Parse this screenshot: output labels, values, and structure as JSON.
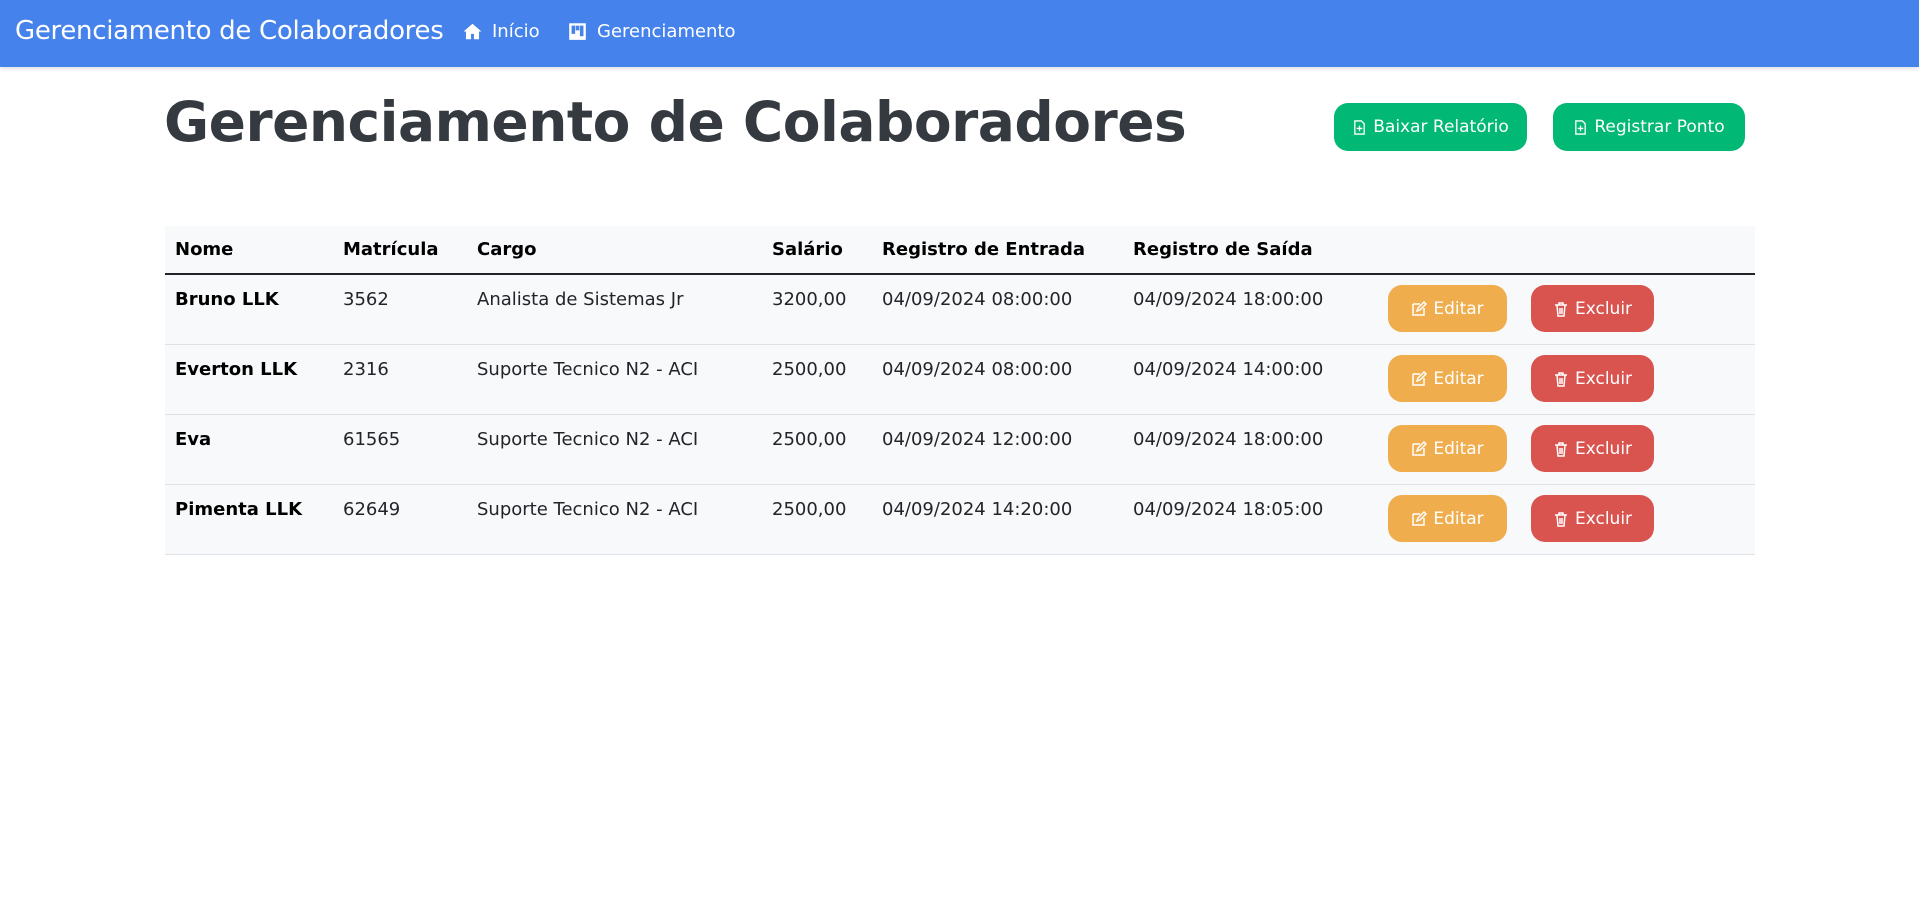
{
  "navbar": {
    "brand": "Gerenciamento de Colaboradores",
    "links": [
      {
        "label": "Início",
        "icon": "home-icon"
      },
      {
        "label": "Gerenciamento",
        "icon": "kanban-icon"
      }
    ],
    "color": "#4582ec"
  },
  "page": {
    "title": "Gerenciamento de Colaboradores",
    "buttons": {
      "report": "Baixar Relatório",
      "register": "Registrar Ponto"
    }
  },
  "table": {
    "headers": [
      "Nome",
      "Matrícula",
      "Cargo",
      "Salário",
      "Registro de Entrada",
      "Registro de Saída"
    ],
    "rows": [
      {
        "nome": "Bruno LLK",
        "matricula": "3562",
        "cargo": "Analista de Sistemas Jr",
        "salario": "3200,00",
        "entrada": "04/09/2024 08:00:00",
        "saida": "04/09/2024 18:00:00"
      },
      {
        "nome": "Everton LLK",
        "matricula": "2316",
        "cargo": "Suporte Tecnico N2 - ACI",
        "salario": "2500,00",
        "entrada": "04/09/2024 08:00:00",
        "saida": "04/09/2024 14:00:00"
      },
      {
        "nome": "Eva",
        "matricula": "61565",
        "cargo": "Suporte Tecnico N2 - ACI",
        "salario": "2500,00",
        "entrada": "04/09/2024 12:00:00",
        "saida": "04/09/2024 18:00:00"
      },
      {
        "nome": "Pimenta LLK",
        "matricula": "62649",
        "cargo": "Suporte Tecnico N2 - ACI",
        "salario": "2500,00",
        "entrada": "04/09/2024 14:20:00",
        "saida": "04/09/2024 18:05:00"
      }
    ],
    "actions": {
      "edit": "Editar",
      "delete": "Excluir"
    }
  },
  "colors": {
    "success": "#02b875",
    "warning": "#f0ad4e",
    "danger": "#d9534f"
  }
}
